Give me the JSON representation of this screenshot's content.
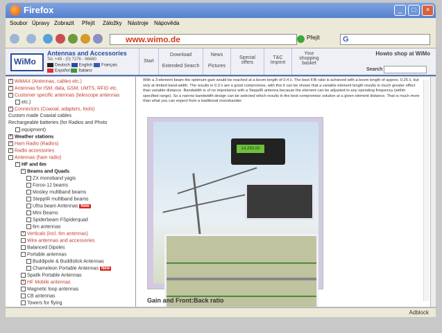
{
  "window": {
    "title": "Firefox"
  },
  "menu": [
    "Soubor",
    "Úpravy",
    "Zobrazit",
    "Přejít",
    "Záložky",
    "Nástroje",
    "Nápověda"
  ],
  "nav": {
    "url": "www.wimo.de",
    "go_label": "Přejít",
    "search_engine_icon": "google-icon"
  },
  "site": {
    "logo": "WiMo",
    "brand": "Antennas and Accessories",
    "tel": "Tel. +49 - (0) 7276 - 96680",
    "languages": [
      "Deutsch",
      "English",
      "Français",
      "Español",
      "Italiano"
    ],
    "nav_start": "Start",
    "nav_download": "Download",
    "nav_extended_search": "Extended Search",
    "nav_news": "News",
    "nav_pictures": "Pictures",
    "nav_special_offers_1": "Special",
    "nav_special_offers_2": "offers",
    "nav_tc_1": "T&C",
    "nav_tc_2": "Imprint",
    "nav_basket_1": "Your",
    "nav_basket_2": "shopping",
    "nav_basket_3": "basket",
    "howto": "Howto shop at WiMo",
    "search_label": "Search"
  },
  "sidebar": {
    "items": [
      {
        "label": "WiMAX (Antennas, cables etc.)",
        "box": "+"
      },
      {
        "label": "Antennas for ISM, data, GSM, UMTS, RFID etc.",
        "box": "+"
      },
      {
        "label": "Customer specific antennas (telescope antennas",
        "box": "+"
      },
      {
        "label": "etc.)",
        "box": ""
      },
      {
        "label": "Connectors (Coaxial, adapters, tools)",
        "box": "+"
      },
      {
        "label": "Custom made Coaxial cables",
        "box": ""
      },
      {
        "label": "Rechargeable batteries (for Radios and Photo",
        "box": ""
      },
      {
        "label": "equipment)",
        "box": ""
      },
      {
        "label": "Weather stations",
        "box": "+"
      },
      {
        "label": "Ham Radio (Radios)",
        "box": "+"
      },
      {
        "label": "Radio accessories",
        "box": "+"
      },
      {
        "label": "Antennas (ham radio)",
        "box": "-"
      },
      {
        "label": "HF and 6m",
        "box": "-"
      },
      {
        "label": "Beams and Quads",
        "box": "-"
      },
      {
        "label": "ZX monoband yagis",
        "box": ""
      },
      {
        "label": "Force-12 beams",
        "box": ""
      },
      {
        "label": "Mosley multiband beams",
        "box": ""
      },
      {
        "label": "SteppIR multiband beams",
        "box": ""
      },
      {
        "label": "Ultra beam Antennas",
        "box": ""
      },
      {
        "label": "Mini Beams",
        "box": ""
      },
      {
        "label": "Spiderbeam FSpiderquad",
        "box": ""
      },
      {
        "label": "6m antennas",
        "box": ""
      },
      {
        "label": "Verticals (incl. 6m antennas)",
        "box": "+"
      },
      {
        "label": "Wire antennas and accessories",
        "box": ""
      },
      {
        "label": "Balanced Dipoles",
        "box": ""
      },
      {
        "label": "Portable antennas",
        "box": ""
      },
      {
        "label": "Buddipole & Buddistick Antennas",
        "box": ""
      },
      {
        "label": "Chameleon Portable Antennas",
        "box": ""
      },
      {
        "label": "Spatik Portable Antennas",
        "box": ""
      },
      {
        "label": "HF Mobile antennas",
        "box": "+"
      },
      {
        "label": "Magnetic loop antennas",
        "box": ""
      },
      {
        "label": "CB antennas",
        "box": ""
      },
      {
        "label": "Towers for flying",
        "box": ""
      }
    ],
    "new_label": "New"
  },
  "main": {
    "text": "With a 3-element beam the optimum gain would be reached at a boom length of 0.4 λ. The best F/B ratio is achieved with a boom length of approx. 0.25 λ, but only at limited band-width. The results in 0.3 λ are a good compromise, with this it can be shown that a variable element length results in much greater effect than variable distance. Bandwidth is of no importance with a SteppIR antenna because the element can be adjusted to any operating frequency (within specified range). So a narrow bandwidth design can be selected which results in the best compromise solution at a given element distance. That is much more than what you can expect from a traditional monobander.",
    "radio_display": "14.250.00",
    "subtitle": "Gain and Front:Back ratio"
  },
  "status": {
    "text": "Adblock"
  }
}
